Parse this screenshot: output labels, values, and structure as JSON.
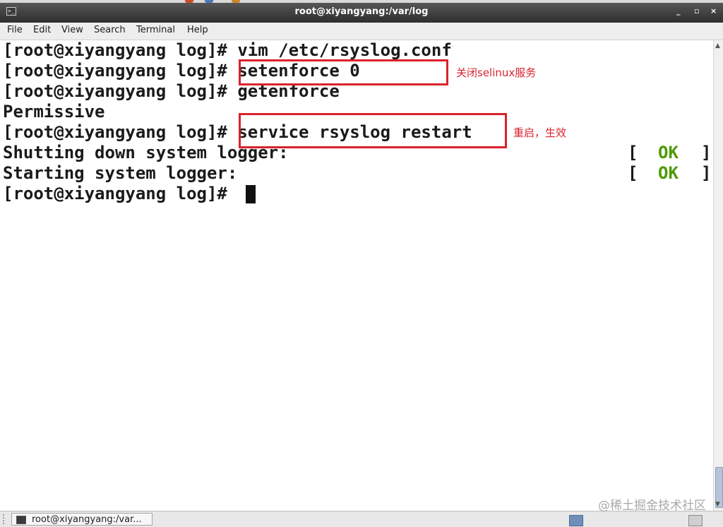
{
  "window": {
    "title": "root@xiyangyang:/var/log",
    "icon": "terminal-icon",
    "controls": [
      "minimize-icon",
      "maximize-icon",
      "close-icon"
    ]
  },
  "menu": {
    "items": [
      "File",
      "Edit",
      "View",
      "Search",
      "Terminal",
      "Help"
    ]
  },
  "terminal": {
    "lines": [
      "[root@xiyangyang log]# vim /etc/rsyslog.conf",
      "[root@xiyangyang log]# setenforce 0",
      "[root@xiyangyang log]# getenforce",
      "Permissive",
      "[root@xiyangyang log]# service rsyslog restart",
      "Shutting down system logger:",
      "Starting system logger:",
      "[root@xiyangyang log]# "
    ],
    "status": {
      "open": "[",
      "ok": "OK",
      "close": "]"
    },
    "colors": {
      "ok": "#4e9a06",
      "text": "#1a1a1a",
      "annotation": "#d9232d"
    }
  },
  "annotations": [
    "关闭selinux服务",
    "重启，生效"
  ],
  "taskbar": {
    "task_label": "root@xiyangyang:/var..."
  },
  "watermark": "@稀土掘金技术社区"
}
